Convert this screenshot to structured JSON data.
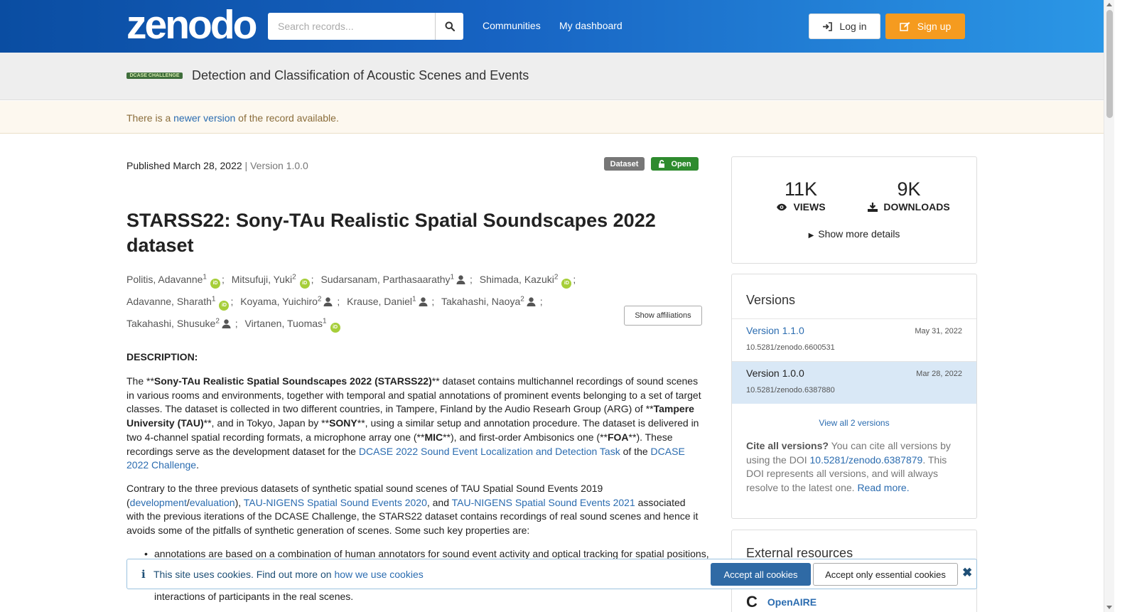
{
  "header": {
    "logo": "zenodo",
    "search_placeholder": "Search records...",
    "nav": [
      "Communities",
      "My dashboard"
    ],
    "login": "Log in",
    "signup": "Sign up"
  },
  "community": {
    "logo_text": "DCASE CHALLENGE",
    "title": "Detection and Classification of Acoustic Scenes and Events"
  },
  "notice": {
    "before": "There is a ",
    "link": "newer version",
    "after": " of the record available."
  },
  "record": {
    "published_label": "Published March 28, 2022",
    "version_label": " | Version 1.0.0",
    "badge_type": "Dataset",
    "badge_access": "Open",
    "title": "STARSS22: Sony-TAu Realistic Spatial Soundscapes 2022 dataset",
    "show_affiliations": "Show affiliations"
  },
  "authors": [
    {
      "name": "Politis, Adavanne",
      "aff": "1",
      "icon": "orcid"
    },
    {
      "name": "Mitsufuji, Yuki",
      "aff": "2",
      "icon": "orcid"
    },
    {
      "name": "Sudarsanam, Parthasaarathy",
      "aff": "1",
      "icon": "person"
    },
    {
      "name": "Shimada, Kazuki",
      "aff": "2",
      "icon": "orcid"
    },
    {
      "name": "Adavanne, Sharath",
      "aff": "1",
      "icon": "orcid"
    },
    {
      "name": "Koyama, Yuichiro",
      "aff": "2",
      "icon": "person"
    },
    {
      "name": "Krause, Daniel",
      "aff": "1",
      "icon": "person"
    },
    {
      "name": "Takahashi, Naoya",
      "aff": "2",
      "icon": "person"
    },
    {
      "name": "Takahashi, Shusuke",
      "aff": "2",
      "icon": "person"
    },
    {
      "name": "Virtanen, Tuomas",
      "aff": "1",
      "icon": "orcid"
    }
  ],
  "description": {
    "heading": "DESCRIPTION:",
    "p1": [
      {
        "t": "The **"
      },
      {
        "t": "Sony-TAu Realistic Spatial Soundscapes 2022 (STARSS22)",
        "b": true
      },
      {
        "t": "** dataset contains multichannel recordings of sound scenes in various rooms and environments, together with temporal and spatial annotations of prominent events belonging to a set of target classes. The dataset is collected in two different countries, in Tampere, Finland by the Audio Researh Group (ARG) of **"
      },
      {
        "t": "Tampere University (TAU)",
        "b": true
      },
      {
        "t": "**, and in Tokyo, Japan by **"
      },
      {
        "t": "SONY",
        "b": true
      },
      {
        "t": "**, using a similar setup and annotation procedure. The dataset is delivered in two 4-channel spatial recording formats, a microphone array one (**"
      },
      {
        "t": "MIC",
        "b": true
      },
      {
        "t": "**), and first-order Ambisonics one (**"
      },
      {
        "t": "FOA",
        "b": true
      },
      {
        "t": "**). These recordings serve as the development dataset for the "
      },
      {
        "t": "DCASE 2022 Sound Event Localization and Detection Task",
        "a": true
      },
      {
        "t": " of the "
      },
      {
        "t": "DCASE 2022 Challenge",
        "a": true
      },
      {
        "t": "."
      }
    ],
    "p2": [
      {
        "t": "Contrary to the three previous datasets of synthetic spatial sound scenes of TAU Spatial Sound Events 2019 ("
      },
      {
        "t": "development",
        "a": true
      },
      {
        "t": "/"
      },
      {
        "t": "evaluation",
        "a": true
      },
      {
        "t": "), "
      },
      {
        "t": "TAU-NIGENS Spatial Sound Events 2020",
        "a": true
      },
      {
        "t": ", and "
      },
      {
        "t": "TAU-NIGENS Spatial Sound Events 2021",
        "a": true
      },
      {
        "t": " associated with the previous iterations of the DCASE Challenge, the STARS22 dataset contains recordings of real sound scenes and hence it avoids some of the pitfalls of synthetic generation of scenes. Some such key properties are:"
      }
    ],
    "bullet1": "annotations are based on a combination of human annotators for sound event activity and optical tracking for spatial positions,",
    "bullet2_tail": "interactions of participants in the real scenes."
  },
  "stats": {
    "views": "11K",
    "views_label": "VIEWS",
    "downloads": "9K",
    "downloads_label": "DOWNLOADS",
    "show_more": "Show more details"
  },
  "versions": {
    "heading": "Versions",
    "items": [
      {
        "name": "Version 1.1.0",
        "date": "May 31, 2022",
        "doi": "10.5281/zenodo.6600531"
      },
      {
        "name": "Version 1.0.0",
        "date": "Mar 28, 2022",
        "doi": "10.5281/zenodo.6387880"
      }
    ],
    "view_all": "View all 2 versions",
    "cite_bold": "Cite all versions?",
    "cite_1": " You can cite all versions by using the DOI ",
    "cite_doi": "10.5281/zenodo.6387879",
    "cite_2": ". This DOI represents all versions, and will always resolve to the latest one. ",
    "cite_more": "Read more."
  },
  "external": {
    "heading": "External resources",
    "item": "OpenAIRE"
  },
  "cookie": {
    "text": "This site uses cookies. Find out more on ",
    "link": "how we use cookies",
    "accept_all": "Accept all cookies",
    "accept_essential": "Accept only essential cookies"
  },
  "colors": {
    "header_start": "#0a4da2",
    "header_end": "#2b97e6",
    "signup": "#f59b1f",
    "orcid": "#a6ce39",
    "open_badge": "#2e8b2e",
    "link": "#2b6cb0"
  }
}
